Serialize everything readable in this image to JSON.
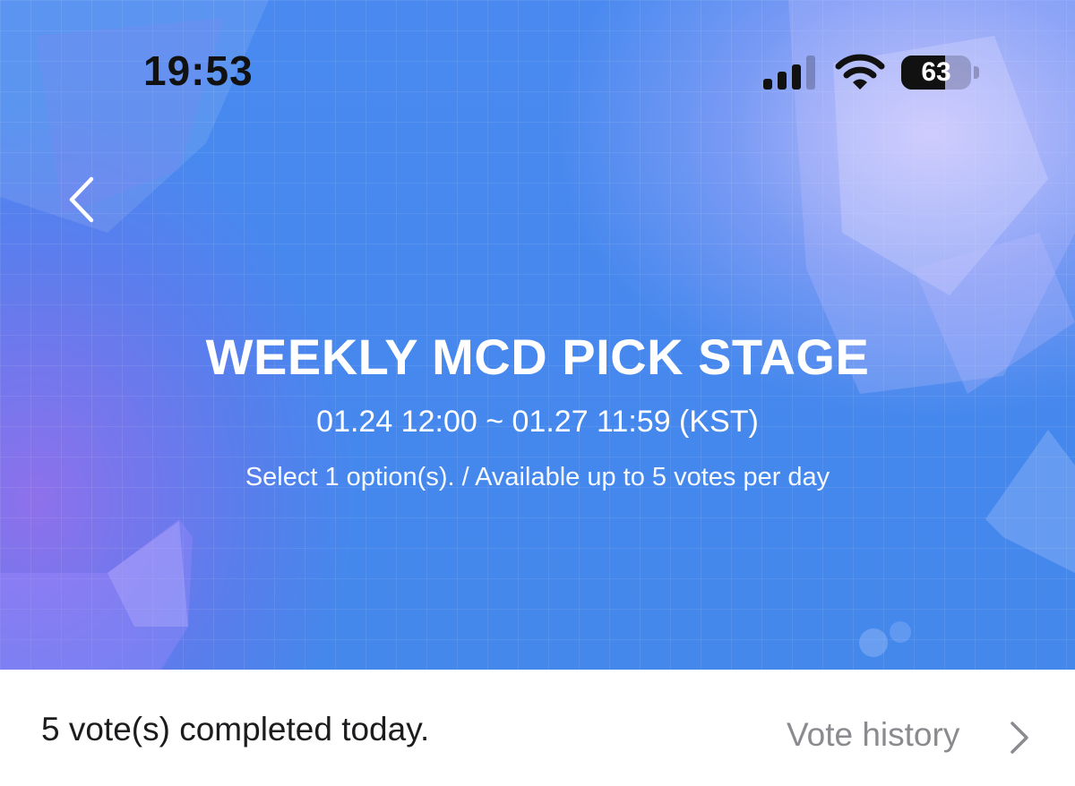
{
  "status_bar": {
    "time": "19:53",
    "battery_level": "63",
    "battery_fraction": 0.63,
    "signal_bars_active": 3,
    "signal_bars_total": 4
  },
  "navigation": {
    "back_icon": "chevron-left-icon"
  },
  "banner": {
    "title": "WEEKLY MCD PICK STAGE",
    "period": "01.24 12:00 ~ 01.27 11:59 (KST)",
    "rules": "Select 1 option(s). / Available up to 5 votes per day"
  },
  "vote_bar": {
    "status": "5 vote(s) completed today.",
    "history_label": "Vote history",
    "history_icon": "chevron-right-icon"
  },
  "colors": {
    "hero_blue": "#4688ee",
    "hero_purple": "#9a6ee8",
    "text_dark": "#1c1c1e",
    "text_muted": "#8a8a8f"
  }
}
